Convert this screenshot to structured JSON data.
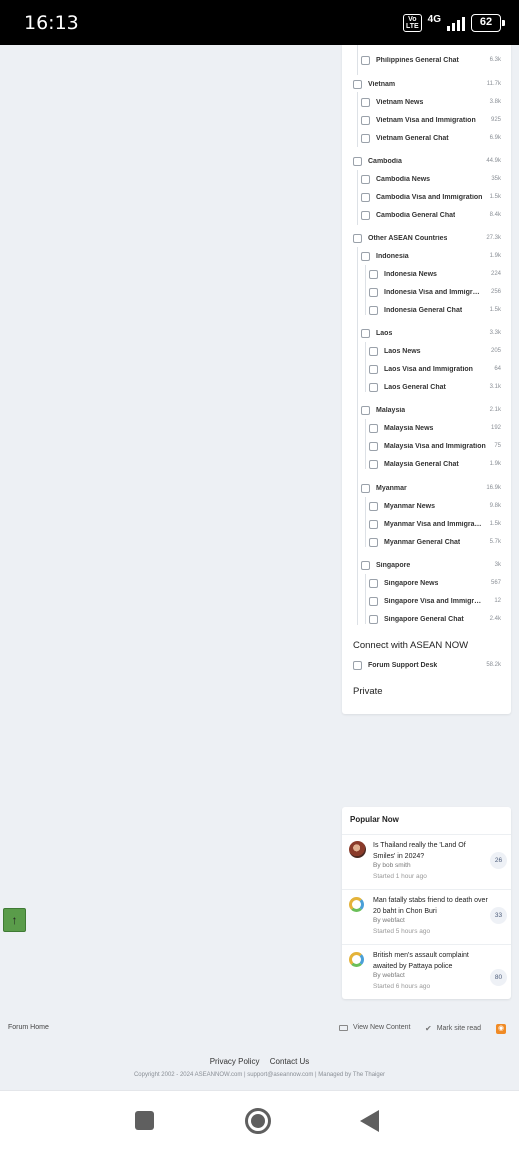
{
  "status_bar": {
    "time": "16:13",
    "volte_top": "Vo",
    "volte_bottom": "LTE",
    "network": "4G",
    "battery": "62"
  },
  "forums": [
    {
      "label": "Philippines General Chat",
      "count": "6.3k"
    },
    {
      "label": "Vietnam",
      "count": "11.7k"
    },
    {
      "label": "Vietnam News",
      "count": "3.8k"
    },
    {
      "label": "Vietnam Visa and Immigration",
      "count": "925"
    },
    {
      "label": "Vietnam General Chat",
      "count": "6.9k"
    },
    {
      "label": "Cambodia",
      "count": "44.9k"
    },
    {
      "label": "Cambodia News",
      "count": "35k"
    },
    {
      "label": "Cambodia Visa and Immigration",
      "count": "1.5k"
    },
    {
      "label": "Cambodia General Chat",
      "count": "8.4k"
    },
    {
      "label": "Other ASEAN Countries",
      "count": "27.3k"
    },
    {
      "label": "Indonesia",
      "count": "1.9k"
    },
    {
      "label": "Indonesia News",
      "count": "224"
    },
    {
      "label": "Indonesia Visa and Immigration",
      "count": "256"
    },
    {
      "label": "Indonesia General Chat",
      "count": "1.5k"
    },
    {
      "label": "Laos",
      "count": "3.3k"
    },
    {
      "label": "Laos News",
      "count": "205"
    },
    {
      "label": "Laos Visa and Immigration",
      "count": "64"
    },
    {
      "label": "Laos General Chat",
      "count": "3.1k"
    },
    {
      "label": "Malaysia",
      "count": "2.1k"
    },
    {
      "label": "Malaysia News",
      "count": "192"
    },
    {
      "label": "Malaysia Visa and Immigration",
      "count": "75"
    },
    {
      "label": "Malaysia General Chat",
      "count": "1.9k"
    },
    {
      "label": "Myanmar",
      "count": "16.9k"
    },
    {
      "label": "Myanmar News",
      "count": "9.8k"
    },
    {
      "label": "Myanmar Visa and Immigration",
      "count": "1.5k"
    },
    {
      "label": "Myanmar General Chat",
      "count": "5.7k"
    },
    {
      "label": "Singapore",
      "count": "3k"
    },
    {
      "label": "Singapore News",
      "count": "567"
    },
    {
      "label": "Singapore Visa and Immigration",
      "count": "12"
    },
    {
      "label": "Singapore General Chat",
      "count": "2.4k"
    },
    {
      "label": "Forum Support Desk",
      "count": "58.2k"
    }
  ],
  "sections": {
    "connect": "Connect with ASEAN NOW",
    "private": "Private"
  },
  "popular": {
    "title": "Popular Now",
    "items": [
      {
        "title": "Is Thailand really the 'Land Of Smiles' in 2024?",
        "by": "By",
        "author": "bob smith",
        "started": "Started 1 hour ago",
        "replies": "26",
        "avatar": "photo-avatar"
      },
      {
        "title": "Man fatally stabs friend to death over 20 baht in Chon Buri",
        "by": "By",
        "author": "webfact",
        "started": "Started 5 hours ago",
        "replies": "33",
        "avatar": "ring-avatar"
      },
      {
        "title": "British men's assault complaint awaited by Pattaya police",
        "by": "By",
        "author": "webfact",
        "started": "Started 6 hours ago",
        "replies": "80",
        "avatar": "ring-avatar"
      }
    ]
  },
  "scroll_top": {
    "icon": "arrow-up-icon",
    "glyph": "↑"
  },
  "footer": {
    "forum_home": "Forum Home",
    "view_new_content": "View New Content",
    "mark_site_read": "Mark site read",
    "privacy_policy": "Privacy Policy",
    "contact_us": "Contact Us",
    "copyright": "Copyright 2002 - 2024 ASEANNOW.com | support@aseannow.com | Managed by The Thaiger"
  },
  "colors": {
    "accent": "#5a9c4a",
    "background": "#edf0f4",
    "rss": "#f08a24"
  }
}
